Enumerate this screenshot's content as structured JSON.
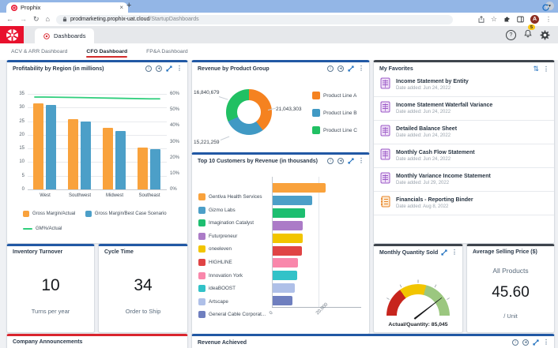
{
  "browser": {
    "tab_title": "Prophix",
    "url_host": "prodmarketing.prophix-uat.cloud",
    "url_path": "/StartupDashboards",
    "avatar_letter": "A",
    "new_tab_label": "+",
    "close_tab_label": "×"
  },
  "app_bar": {
    "tab_label": "Dashboards",
    "notification_count": "5",
    "help_label": "?"
  },
  "dash_tabs": [
    {
      "label": "ACV & ARR Dashboard",
      "active": false
    },
    {
      "label": "CFO Dashboard",
      "active": true
    },
    {
      "label": "FP&A Dashboard",
      "active": false
    }
  ],
  "cards": {
    "profitability": {
      "title": "Profitability by Region (in millions)"
    },
    "revenue_group": {
      "title": "Revenue by Product Group"
    },
    "top10": {
      "title": "Top 10 Customers by Revenue (in thousands)"
    },
    "favorites": {
      "title": "My Favorites",
      "items": [
        {
          "title": "Income Statement by Entity",
          "date": "Date added: Jun 24, 2022",
          "icon": "report"
        },
        {
          "title": "Income Statement Waterfall Variance",
          "date": "Date added: Jun 24, 2022",
          "icon": "report"
        },
        {
          "title": "Detailed Balance Sheet",
          "date": "Date added: Jun 24, 2022",
          "icon": "report"
        },
        {
          "title": "Monthly Cash Flow Statement",
          "date": "Date added: Jun 24, 2022",
          "icon": "report"
        },
        {
          "title": "Monthly Variance Income Statement",
          "date": "Date added: Jul 29, 2022",
          "icon": "report"
        },
        {
          "title": "Financials - Reporting Binder",
          "date": "Date added: Aug 8, 2022",
          "icon": "binder"
        }
      ]
    },
    "inventory": {
      "title": "Inventory Turnover",
      "value": "10",
      "caption": "Turns per year"
    },
    "cycle": {
      "title": "Cycle Time",
      "value": "34",
      "caption": "Order to Ship"
    },
    "gauge": {
      "title": "Monthly Quantity Sold"
    },
    "asp": {
      "title": "Average Selling Price ($)",
      "line1": "All Products",
      "value": "45.60",
      "caption": "/ Unit"
    },
    "announcements": {
      "title": "Company Announcements"
    },
    "revenue_achieved": {
      "title": "Revenue Achieved"
    }
  },
  "colors": {
    "accent_blue": "#2158A4",
    "accent_dark": "#3E444C",
    "accent_red": "#D9252E",
    "icon_blue": "#1E6FBF",
    "prophix_red": "#E8112D",
    "badge_yellow": "#F9C513"
  },
  "chart_data": [
    {
      "id": "profitability",
      "type": "bar",
      "title": "Profitability by Region (in millions)",
      "categories": [
        "West",
        "Southwest",
        "Midwest",
        "Southeast"
      ],
      "series": [
        {
          "name": "Gross Margin/Actual",
          "type": "bar",
          "color": "#F9A23C",
          "values": [
            31.4,
            25.6,
            22.5,
            15.3
          ]
        },
        {
          "name": "Gross Margin/Best Case Scenario",
          "type": "bar",
          "color": "#4C9FC8",
          "values": [
            31.0,
            24.8,
            21.5,
            14.7
          ]
        },
        {
          "name": "GM%/Actual",
          "type": "line",
          "axis": "right",
          "color": "#2FCE7C",
          "values": [
            58,
            57.7,
            57.3,
            56.9
          ]
        }
      ],
      "left_axis": {
        "min": 0,
        "max": 35,
        "step": 5,
        "ticks": [
          "0",
          "5",
          "10",
          "15",
          "20",
          "25",
          "30",
          "35"
        ]
      },
      "right_axis": {
        "min": 0,
        "max": 60,
        "step": 10,
        "ticks": [
          "0%",
          "10%",
          "20%",
          "30%",
          "40%",
          "50%",
          "60%"
        ]
      },
      "grid": true,
      "legend_position": "bottom"
    },
    {
      "id": "revenue_by_product_group",
      "type": "pie",
      "donut": true,
      "title": "Revenue by Product Group",
      "slices": [
        {
          "label": "Product Line A",
          "value": 21043303,
          "display": "21,043,303",
          "color": "#F58220"
        },
        {
          "label": "Product Line B",
          "value": 15221259,
          "display": "15,221,259",
          "color": "#4099C4"
        },
        {
          "label": "Product Line C",
          "value": 16840679,
          "display": "16,840,679",
          "color": "#21C063"
        }
      ],
      "legend_position": "right"
    },
    {
      "id": "top10_customers",
      "type": "bar",
      "orientation": "horizontal",
      "title": "Top 10 Customers by Revenue (in thousands)",
      "x_axis": {
        "min": 0,
        "max": 28000,
        "ticks": [
          "0",
          "20,000"
        ],
        "tick_values": [
          0,
          20000
        ]
      },
      "bars": [
        {
          "label": "Gentiva Health Services",
          "value": 22600,
          "color": "#F9A23C"
        },
        {
          "label": "Gizmo Labs",
          "value": 16800,
          "color": "#4C9FC8"
        },
        {
          "label": "Imagination Catalyst",
          "value": 13900,
          "color": "#1DBE70"
        },
        {
          "label": "Futurpreneur",
          "value": 12900,
          "color": "#AB7BC7"
        },
        {
          "label": "oneeleven",
          "value": 12900,
          "color": "#F2C500"
        },
        {
          "label": "HIGHLINE",
          "value": 12500,
          "color": "#E04445"
        },
        {
          "label": "Innovation York",
          "value": 11000,
          "color": "#F987AB"
        },
        {
          "label": "ideaBOOST",
          "value": 10400,
          "color": "#32C2C8"
        },
        {
          "label": "Artscape",
          "value": 9400,
          "color": "#AFC0E8"
        },
        {
          "label": "General Cable Corporat...",
          "value": 8500,
          "color": "#6F7FBF"
        }
      ],
      "legend_position": "left",
      "grid": true
    },
    {
      "id": "monthly_quantity_sold",
      "type": "gauge",
      "title": "Monthly Quantity Sold",
      "label": "Actual/Quantity: 85,045",
      "value_fraction": 0.79,
      "segments": [
        {
          "color": "#C7251D",
          "to": 0.305
        },
        {
          "color": "#F2C500",
          "to": 0.583
        },
        {
          "color": "#9BC77F",
          "to": 1.0
        }
      ]
    }
  ]
}
